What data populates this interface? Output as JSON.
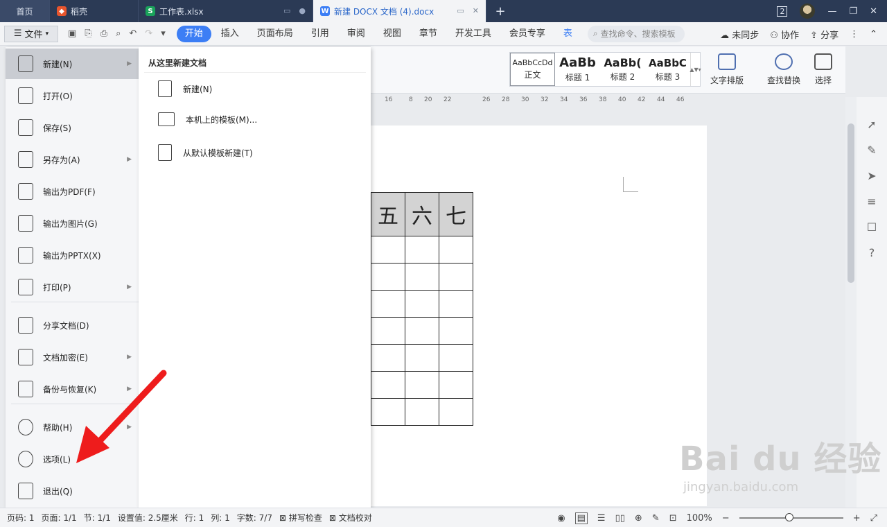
{
  "titlebar": {
    "tabs": [
      {
        "label": "首页"
      },
      {
        "label": "稻壳"
      },
      {
        "label": "工作表.xlsx"
      },
      {
        "label": "新建 DOCX 文档 (4).docx"
      }
    ],
    "window_count": "2"
  },
  "menubar": {
    "file_label": "文件",
    "tabs": [
      "开始",
      "插入",
      "页面布局",
      "引用",
      "审阅",
      "视图",
      "章节",
      "开发工具",
      "会员专享",
      "表"
    ],
    "search_placeholder": "查找命令、搜索模板",
    "right": [
      "未同步",
      "协作",
      "分享"
    ]
  },
  "ribbon": {
    "styles": [
      {
        "sample": "AaBbCcDd",
        "label": "正文"
      },
      {
        "sample": "AaBb",
        "label": "标题 1"
      },
      {
        "sample": "AaBb(",
        "label": "标题 2"
      },
      {
        "sample": "AaBbC",
        "label": "标题 3"
      }
    ],
    "buttons": [
      "文字排版",
      "查找替换",
      "选择"
    ]
  },
  "ruler": [
    "16",
    "8",
    "20",
    "22",
    "26",
    "28",
    "30",
    "32",
    "34",
    "36",
    "38",
    "40",
    "42",
    "44",
    "46"
  ],
  "table": {
    "headers": [
      "五",
      "六",
      "七"
    ],
    "body_rows": 7
  },
  "file_menu": {
    "items": [
      {
        "label": "新建(N)",
        "submenu": true
      },
      {
        "label": "打开(O)",
        "submenu": false
      },
      {
        "label": "保存(S)",
        "submenu": false
      },
      {
        "label": "另存为(A)",
        "submenu": true
      },
      {
        "label": "输出为PDF(F)",
        "submenu": false
      },
      {
        "label": "输出为图片(G)",
        "submenu": false
      },
      {
        "label": "输出为PPTX(X)",
        "submenu": false
      },
      {
        "label": "打印(P)",
        "submenu": true
      },
      {
        "label": "分享文档(D)",
        "submenu": false
      },
      {
        "label": "文档加密(E)",
        "submenu": true
      },
      {
        "label": "备份与恢复(K)",
        "submenu": true
      },
      {
        "label": "帮助(H)",
        "submenu": true
      },
      {
        "label": "选项(L)",
        "submenu": false
      },
      {
        "label": "退出(Q)",
        "submenu": false
      }
    ]
  },
  "submenu": {
    "heading": "从这里新建文档",
    "items": [
      "新建(N)",
      "本机上的模板(M)...",
      "从默认模板新建(T)"
    ]
  },
  "statusbar": {
    "left": [
      "页码: 1",
      "页面: 1/1",
      "节: 1/1",
      "设置值: 2.5厘米",
      "行: 1",
      "列: 1",
      "字数: 7/7",
      "拼写检查",
      "文档校对"
    ],
    "zoom": "100%"
  },
  "watermark": {
    "brand": "Bai du 经验",
    "url": "jingyan.baidu.com"
  },
  "colors": {
    "accent": "#3c7ef5",
    "titlebar": "#2b3a55",
    "annotation": "#ee1c1c"
  }
}
